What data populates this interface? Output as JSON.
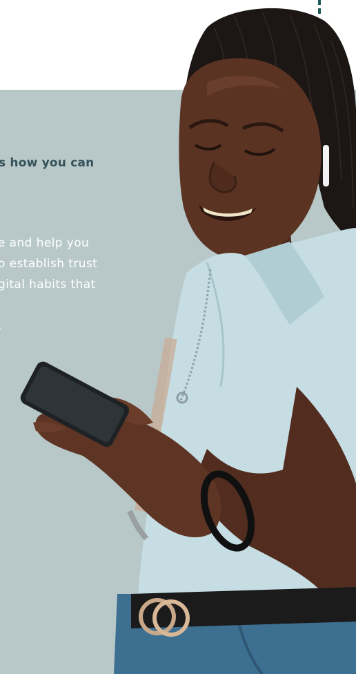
{
  "hero": {
    "headline_visible": "s how you can",
    "body_lines": [
      "e and help you",
      "o establish trust",
      "gital habits that",
      "."
    ]
  },
  "photo": {
    "description_icon": "person-with-phone-image"
  },
  "colors": {
    "panel": "#b8c8c9",
    "headline": "#35525a",
    "body_text": "#ffffff",
    "accent_mark": "#1e5a57"
  }
}
